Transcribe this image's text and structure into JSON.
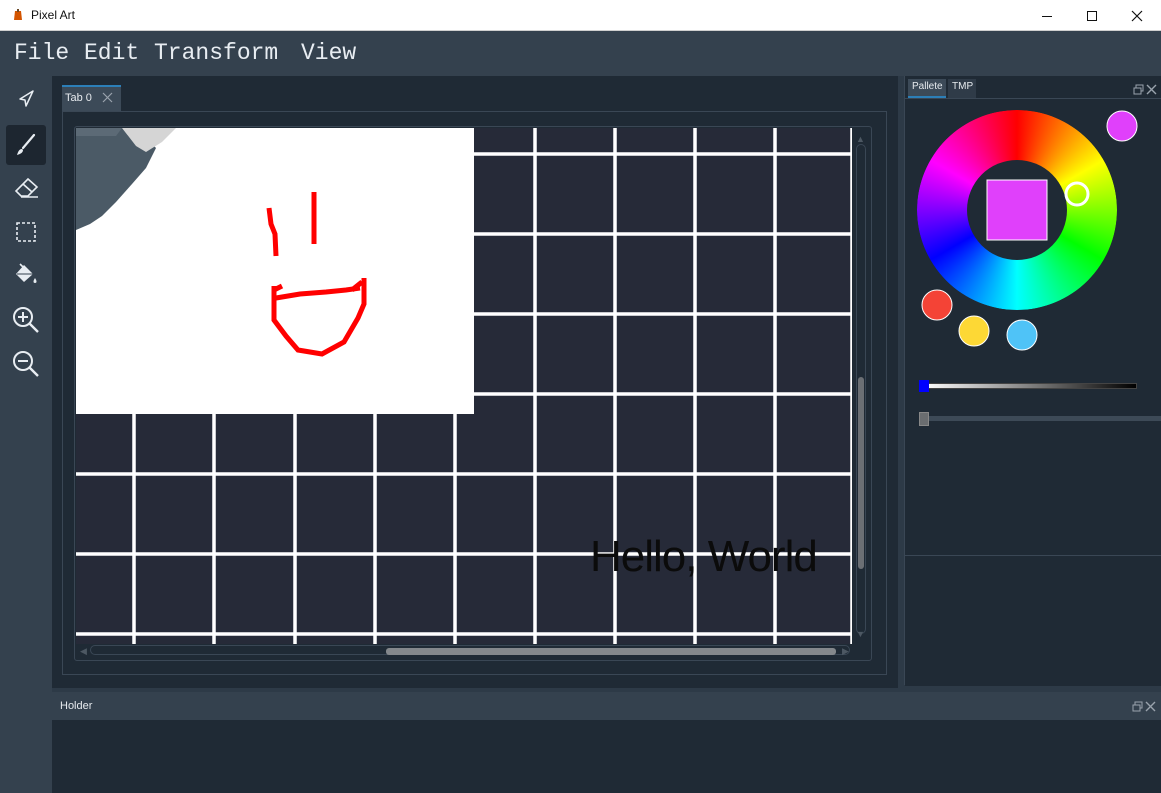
{
  "window": {
    "title": "Pixel Art",
    "icon": "app-icon"
  },
  "window_controls": [
    "minimize-icon",
    "maximize-icon",
    "close-icon"
  ],
  "menu": {
    "items": [
      "File",
      "Edit",
      "Transform",
      "View"
    ]
  },
  "tools": [
    {
      "name": "pointer-tool",
      "icon": "pointer-icon",
      "active": false
    },
    {
      "name": "brush-tool",
      "icon": "brush-icon",
      "active": true
    },
    {
      "name": "eraser-tool",
      "icon": "eraser-icon",
      "active": false
    },
    {
      "name": "select-tool",
      "icon": "select-rect-icon",
      "active": false
    },
    {
      "name": "fill-tool",
      "icon": "paint-bucket-icon",
      "active": false
    },
    {
      "name": "zoom-in-tool",
      "icon": "zoom-in-icon",
      "active": false
    },
    {
      "name": "zoom-out-tool",
      "icon": "zoom-out-icon",
      "active": false
    }
  ],
  "tabs": [
    {
      "label": "Tab 0"
    }
  ],
  "canvas": {
    "text": "Hello, World",
    "grid_color": "#ffffff",
    "background_color": "#262a38",
    "stroke_color": "#ff0000"
  },
  "right_panel": {
    "tabs": [
      {
        "label": "Pallete",
        "active": true
      },
      {
        "label": "TMP",
        "active": false
      }
    ],
    "selected_color": "#e040fb",
    "swatches": [
      "#e040fb",
      "#f44336",
      "#fdd835",
      "#4fc3f7"
    ]
  },
  "bottom_dock": {
    "title": "Holder"
  }
}
